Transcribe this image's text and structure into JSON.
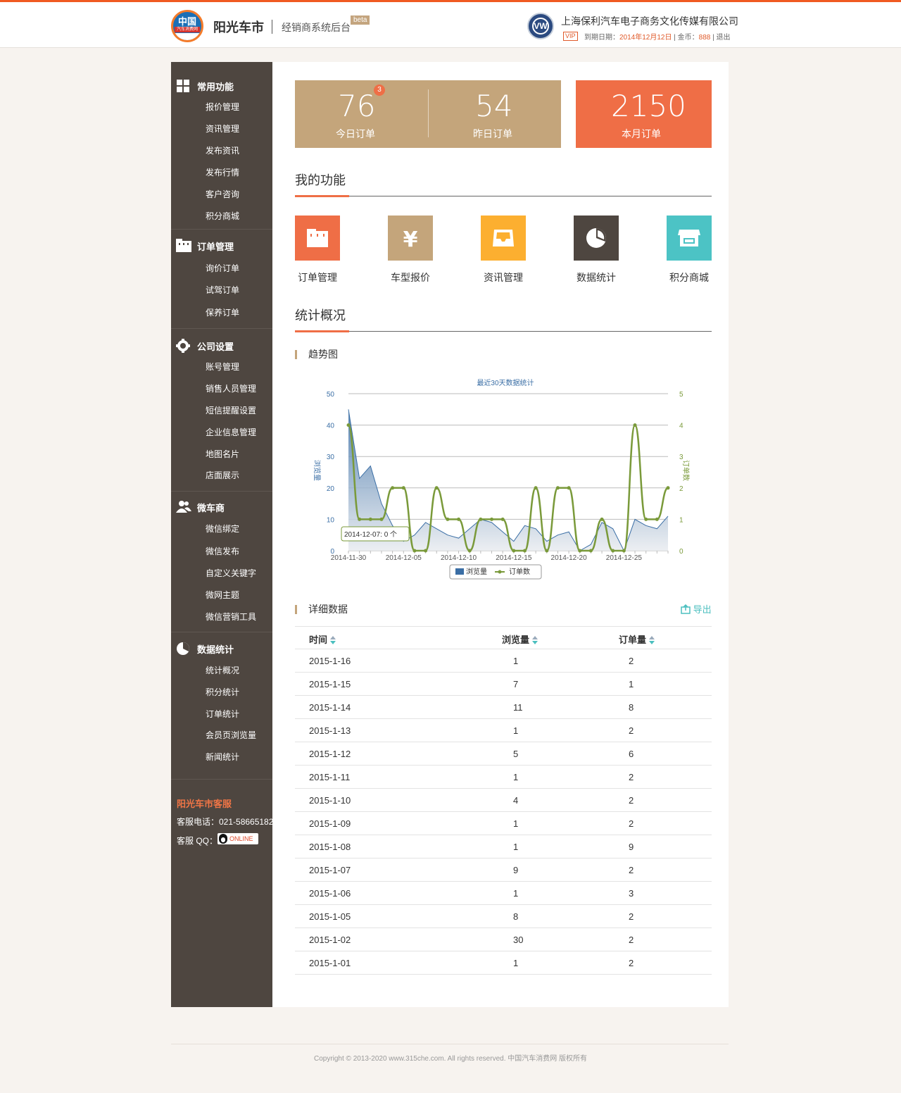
{
  "header": {
    "logo_line1": "中国",
    "logo_line2": "汽车消费网",
    "brand": "阳光车市",
    "subtitle": "经销商系统后台",
    "beta": "beta",
    "vw_glyph": "VW",
    "company": "上海保利汽车电子商务文化传媒有限公司",
    "vip": "VIP",
    "expire_label": "到期日期：",
    "expire_date": "2014年12月12日",
    "coin_label": " | 金币：",
    "coin": "888",
    "logout": " | 退出"
  },
  "sidebar": {
    "sections": [
      {
        "title": "常用功能",
        "icon": "grid-icon",
        "items": [
          "报价管理",
          "资讯管理",
          "发布资讯",
          "发布行情",
          "客户咨询",
          "积分商城"
        ]
      },
      {
        "title": "订单管理",
        "icon": "folder-icon",
        "items": [
          "询价订单",
          "试驾订单",
          "保养订单"
        ]
      },
      {
        "title": "公司设置",
        "icon": "gear-icon",
        "items": [
          "账号管理",
          "销售人员管理",
          "短信提醒设置",
          "企业信息管理",
          "地图名片",
          "店面展示"
        ]
      },
      {
        "title": "微车商",
        "icon": "users-icon",
        "items": [
          "微信绑定",
          "微信发布",
          "自定义关键字",
          "微网主题",
          "微信营销工具"
        ]
      },
      {
        "title": "数据统计",
        "icon": "pie-icon",
        "items": [
          "统计概况",
          "积分统计",
          "订单统计",
          "会员页浏览量",
          "新闻统计"
        ]
      }
    ],
    "kefu": {
      "title": "阳光车市客服",
      "phone": "客服电话：021-58665182",
      "qq": "客服 QQ：",
      "online": "ONLINE"
    }
  },
  "stats": {
    "today": {
      "value": "76",
      "label": "今日订单",
      "badge": "3"
    },
    "yesterday": {
      "value": "54",
      "label": "昨日订单"
    },
    "month": {
      "value": "2150",
      "label": "本月订单"
    }
  },
  "functions_title": "我的功能",
  "functions": [
    {
      "label": "订单管理",
      "icon": "folder-icon",
      "color": "#ef6e46"
    },
    {
      "label": "车型报价",
      "icon": "yen-icon",
      "color": "#c4a57b"
    },
    {
      "label": "资讯管理",
      "icon": "inbox-icon",
      "color": "#fcaf30"
    },
    {
      "label": "数据统计",
      "icon": "pie-chart-icon",
      "color": "#4e4640"
    },
    {
      "label": "积分商城",
      "icon": "shop-icon",
      "color": "#4cc3c5"
    }
  ],
  "overview_title": "统计概况",
  "trend_title": "趋势图",
  "chart_data": {
    "type": "line",
    "title": "最近30天数据统计",
    "ylabel": "浏览量",
    "ylabel_right": "订单数",
    "x": [
      "2014-11-30",
      "2014-12-01",
      "2014-12-02",
      "2014-12-03",
      "2014-12-04",
      "2014-12-05",
      "2014-12-06",
      "2014-12-07",
      "2014-12-08",
      "2014-12-09",
      "2014-12-10",
      "2014-12-11",
      "2014-12-12",
      "2014-12-13",
      "2014-12-14",
      "2014-12-15",
      "2014-12-16",
      "2014-12-17",
      "2014-12-18",
      "2014-12-19",
      "2014-12-20",
      "2014-12-21",
      "2014-12-22",
      "2014-12-23",
      "2014-12-24",
      "2014-12-25",
      "2014-12-26",
      "2014-12-27",
      "2014-12-28",
      "2014-12-29"
    ],
    "x_tick_labels": [
      "2014-11-30",
      "2014-12-05",
      "2014-12-10",
      "2014-12-15",
      "2014-12-20",
      "2014-12-25"
    ],
    "ylim": [
      0,
      50
    ],
    "y_ticks": [
      "0",
      "10",
      "20",
      "30",
      "40",
      "50"
    ],
    "ylim_right": [
      0,
      5
    ],
    "y_ticks_right": [
      "0",
      "1",
      "2",
      "3",
      "4",
      "5"
    ],
    "series": [
      {
        "name": "浏览量",
        "axis": "left",
        "kind": "area",
        "color": "#3a6ea5",
        "values": [
          45,
          23,
          27,
          15,
          8,
          3,
          5,
          9,
          7,
          5,
          4,
          7,
          10,
          9,
          6,
          3,
          8,
          7,
          3,
          5,
          6,
          0,
          2,
          9,
          7,
          0,
          10,
          8,
          7,
          11
        ]
      },
      {
        "name": "订单数",
        "axis": "right",
        "kind": "line",
        "color": "#7a9a3a",
        "values": [
          4,
          1,
          1,
          1,
          2,
          2,
          0,
          0,
          2,
          1,
          1,
          0,
          1,
          1,
          1,
          0,
          0,
          2,
          0,
          2,
          2,
          0,
          0,
          1,
          0,
          0,
          4,
          1,
          1,
          2
        ]
      }
    ],
    "tooltip": "2014-12-07: 0 个",
    "legend": "bottom-center"
  },
  "detail_title": "详细数据",
  "export": "导出",
  "table": {
    "headers": [
      "时间",
      "浏览量",
      "订单量"
    ],
    "rows": [
      [
        "2015-1-16",
        "1",
        "2"
      ],
      [
        "2015-1-15",
        "7",
        "1"
      ],
      [
        "2015-1-14",
        "11",
        "8"
      ],
      [
        "2015-1-13",
        "1",
        "2"
      ],
      [
        "2015-1-12",
        "5",
        "6"
      ],
      [
        "2015-1-11",
        "1",
        "2"
      ],
      [
        "2015-1-10",
        "4",
        "2"
      ],
      [
        "2015-1-09",
        "1",
        "2"
      ],
      [
        "2015-1-08",
        "1",
        "9"
      ],
      [
        "2015-1-07",
        "9",
        "2"
      ],
      [
        "2015-1-06",
        "1",
        "3"
      ],
      [
        "2015-1-05",
        "8",
        "2"
      ],
      [
        "2015-1-02",
        "30",
        "2"
      ],
      [
        "2015-1-01",
        "1",
        "2"
      ]
    ]
  },
  "footer": "Copyright © 2013-2020 www.315che.com. All rights reserved. 中国汽车消费网 版权所有"
}
